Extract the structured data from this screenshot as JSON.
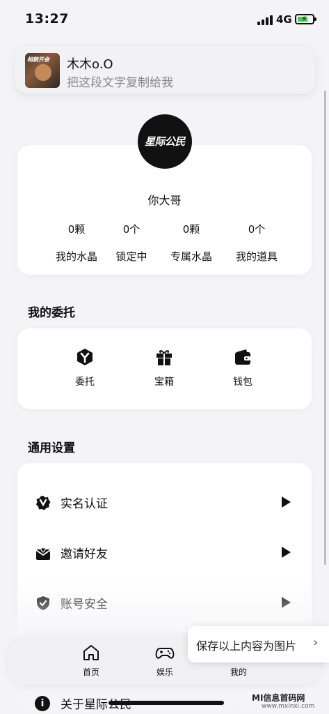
{
  "status_bar": {
    "time": "13:27",
    "network": "4G"
  },
  "banner": {
    "name": "木木o.O",
    "subtitle": "把这段文字复制给我",
    "thumb_text": "相貌开会"
  },
  "profile": {
    "avatar_text": "星际公民",
    "username": "你大哥",
    "stats": [
      {
        "value": "0颗",
        "label": "我的水晶"
      },
      {
        "value": "0个",
        "label": "锁定中"
      },
      {
        "value": "0颗",
        "label": "专属水晶"
      },
      {
        "value": "0个",
        "label": "我的道具"
      }
    ]
  },
  "entrust_section": {
    "title": "我的委托",
    "items": [
      {
        "label": "委托",
        "icon": "entrust-icon"
      },
      {
        "label": "宝箱",
        "icon": "gift-box-icon"
      },
      {
        "label": "钱包",
        "icon": "wallet-icon"
      }
    ]
  },
  "settings_section": {
    "title": "通用设置",
    "items": [
      {
        "label": "实名认证",
        "icon": "verified-badge-icon"
      },
      {
        "label": "邀请好友",
        "icon": "invite-mail-icon"
      },
      {
        "label": "账号安全",
        "icon": "shield-check-icon"
      },
      {
        "label": "关于星际公民",
        "icon": "info-icon"
      }
    ]
  },
  "tabbar": {
    "items": [
      {
        "label": "首页",
        "icon": "home-icon"
      },
      {
        "label": "娱乐",
        "icon": "gamepad-icon"
      },
      {
        "label": "我的",
        "icon": "profile-icon"
      }
    ]
  },
  "save_popup": {
    "label": "保存以上内容为图片",
    "chevron": "›"
  },
  "watermark": {
    "text": "MI信息首码网",
    "url": "www.mxinxi.com"
  },
  "colors": {
    "accent": "#111111",
    "background": "#f4f4f6",
    "card": "#ffffff",
    "battery": "#3ccf4e"
  }
}
